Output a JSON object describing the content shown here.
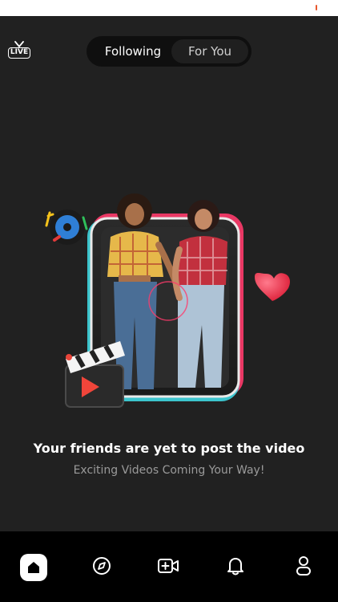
{
  "status": {
    "accent": "#e8572c"
  },
  "header": {
    "live_label": "LIVE",
    "tabs": [
      {
        "label": "Following",
        "active": true
      },
      {
        "label": "For You",
        "active": false
      }
    ]
  },
  "empty_state": {
    "title": "Your friends are yet to post the video",
    "subtitle": "Exciting Videos Coming Your Way!"
  },
  "navbar": {
    "items": [
      {
        "icon": "home-icon",
        "active": true
      },
      {
        "icon": "compass-icon",
        "active": false
      },
      {
        "icon": "video-add-icon",
        "active": false
      },
      {
        "icon": "bell-icon",
        "active": false
      },
      {
        "icon": "profile-icon",
        "active": false
      }
    ]
  },
  "colors": {
    "background": "#212121",
    "navbar": "#000000",
    "frame_pink": "#ff3b6b",
    "frame_cyan": "#3fd6e0",
    "heart": "#f0264a"
  }
}
